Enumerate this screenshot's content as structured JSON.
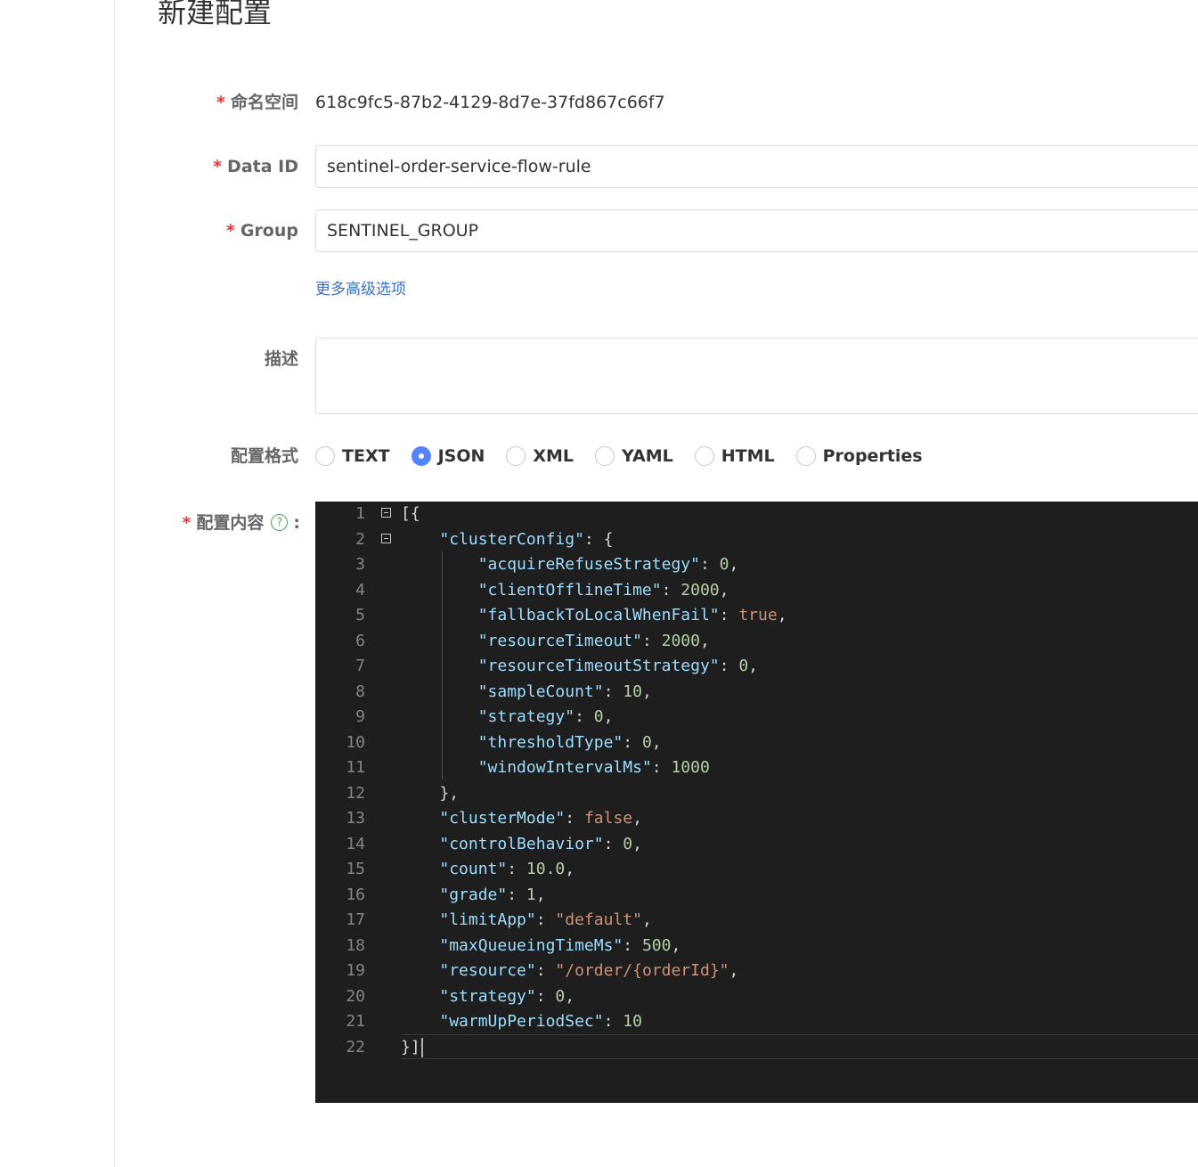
{
  "page": {
    "title": "新建配置"
  },
  "form": {
    "namespace": {
      "label": "命名空间",
      "value": "618c9fc5-87b2-4129-8d7e-37fd867c66f7"
    },
    "data_id": {
      "label": "Data ID",
      "value": "sentinel-order-service-flow-rule"
    },
    "group": {
      "label": "Group",
      "value": "SENTINEL_GROUP"
    },
    "advanced_link": "更多高级选项",
    "description": {
      "label": "描述",
      "value": ""
    },
    "format": {
      "label": "配置格式",
      "selected": "JSON",
      "options": [
        {
          "label": "TEXT"
        },
        {
          "label": "JSON"
        },
        {
          "label": "XML"
        },
        {
          "label": "YAML"
        },
        {
          "label": "HTML"
        },
        {
          "label": "Properties"
        }
      ]
    },
    "content": {
      "label": "配置内容",
      "colon": ":",
      "help_icon": "?"
    }
  },
  "editor": {
    "lines": [
      {
        "num": "1",
        "text": "[{"
      },
      {
        "num": "2",
        "text": "    \"clusterConfig\": {"
      },
      {
        "num": "3",
        "text": "        \"acquireRefuseStrategy\": 0,"
      },
      {
        "num": "4",
        "text": "        \"clientOfflineTime\": 2000,"
      },
      {
        "num": "5",
        "text": "        \"fallbackToLocalWhenFail\": true,"
      },
      {
        "num": "6",
        "text": "        \"resourceTimeout\": 2000,"
      },
      {
        "num": "7",
        "text": "        \"resourceTimeoutStrategy\": 0,"
      },
      {
        "num": "8",
        "text": "        \"sampleCount\": 10,"
      },
      {
        "num": "9",
        "text": "        \"strategy\": 0,"
      },
      {
        "num": "10",
        "text": "        \"thresholdType\": 0,"
      },
      {
        "num": "11",
        "text": "        \"windowIntervalMs\": 1000"
      },
      {
        "num": "12",
        "text": "    },"
      },
      {
        "num": "13",
        "text": "    \"clusterMode\": false,"
      },
      {
        "num": "14",
        "text": "    \"controlBehavior\": 0,"
      },
      {
        "num": "15",
        "text": "    \"count\": 10.0,"
      },
      {
        "num": "16",
        "text": "    \"grade\": 1,"
      },
      {
        "num": "17",
        "text": "    \"limitApp\": \"default\","
      },
      {
        "num": "18",
        "text": "    \"maxQueueingTimeMs\": 500,"
      },
      {
        "num": "19",
        "text": "    \"resource\": \"/order/{orderId}\","
      },
      {
        "num": "20",
        "text": "    \"strategy\": 0,"
      },
      {
        "num": "21",
        "text": "    \"warmUpPeriodSec\": 10"
      },
      {
        "num": "22",
        "text": "}]"
      }
    ]
  },
  "colors": {
    "required": "#e4393c",
    "link": "#3a6fc7",
    "radio_checked": "#5584ff",
    "help": "#4aa552",
    "editor_bg": "#1e1e1e"
  },
  "icons": {
    "help": "question-circle-icon",
    "fold": "fold-toggle-icon"
  }
}
